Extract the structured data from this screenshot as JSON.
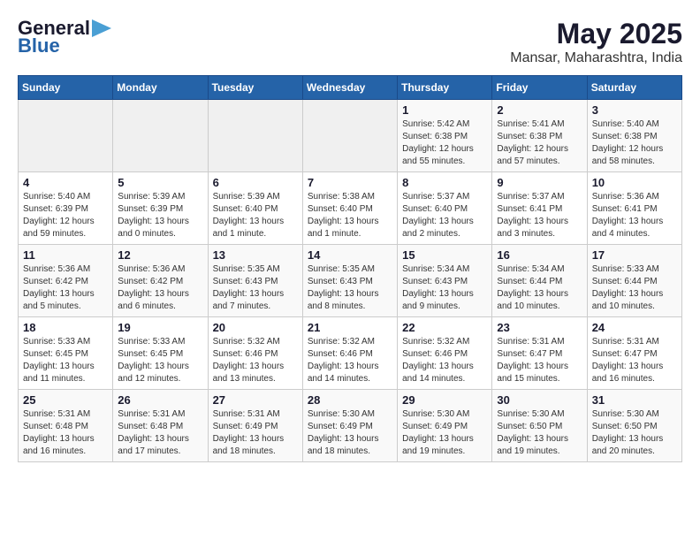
{
  "logo": {
    "line1": "General",
    "line2": "Blue"
  },
  "title": "May 2025",
  "subtitle": "Mansar, Maharashtra, India",
  "days_of_week": [
    "Sunday",
    "Monday",
    "Tuesday",
    "Wednesday",
    "Thursday",
    "Friday",
    "Saturday"
  ],
  "weeks": [
    [
      {
        "day": "",
        "info": ""
      },
      {
        "day": "",
        "info": ""
      },
      {
        "day": "",
        "info": ""
      },
      {
        "day": "",
        "info": ""
      },
      {
        "day": "1",
        "info": "Sunrise: 5:42 AM\nSunset: 6:38 PM\nDaylight: 12 hours\nand 55 minutes."
      },
      {
        "day": "2",
        "info": "Sunrise: 5:41 AM\nSunset: 6:38 PM\nDaylight: 12 hours\nand 57 minutes."
      },
      {
        "day": "3",
        "info": "Sunrise: 5:40 AM\nSunset: 6:38 PM\nDaylight: 12 hours\nand 58 minutes."
      }
    ],
    [
      {
        "day": "4",
        "info": "Sunrise: 5:40 AM\nSunset: 6:39 PM\nDaylight: 12 hours\nand 59 minutes."
      },
      {
        "day": "5",
        "info": "Sunrise: 5:39 AM\nSunset: 6:39 PM\nDaylight: 13 hours\nand 0 minutes."
      },
      {
        "day": "6",
        "info": "Sunrise: 5:39 AM\nSunset: 6:40 PM\nDaylight: 13 hours\nand 1 minute."
      },
      {
        "day": "7",
        "info": "Sunrise: 5:38 AM\nSunset: 6:40 PM\nDaylight: 13 hours\nand 1 minute."
      },
      {
        "day": "8",
        "info": "Sunrise: 5:37 AM\nSunset: 6:40 PM\nDaylight: 13 hours\nand 2 minutes."
      },
      {
        "day": "9",
        "info": "Sunrise: 5:37 AM\nSunset: 6:41 PM\nDaylight: 13 hours\nand 3 minutes."
      },
      {
        "day": "10",
        "info": "Sunrise: 5:36 AM\nSunset: 6:41 PM\nDaylight: 13 hours\nand 4 minutes."
      }
    ],
    [
      {
        "day": "11",
        "info": "Sunrise: 5:36 AM\nSunset: 6:42 PM\nDaylight: 13 hours\nand 5 minutes."
      },
      {
        "day": "12",
        "info": "Sunrise: 5:36 AM\nSunset: 6:42 PM\nDaylight: 13 hours\nand 6 minutes."
      },
      {
        "day": "13",
        "info": "Sunrise: 5:35 AM\nSunset: 6:43 PM\nDaylight: 13 hours\nand 7 minutes."
      },
      {
        "day": "14",
        "info": "Sunrise: 5:35 AM\nSunset: 6:43 PM\nDaylight: 13 hours\nand 8 minutes."
      },
      {
        "day": "15",
        "info": "Sunrise: 5:34 AM\nSunset: 6:43 PM\nDaylight: 13 hours\nand 9 minutes."
      },
      {
        "day": "16",
        "info": "Sunrise: 5:34 AM\nSunset: 6:44 PM\nDaylight: 13 hours\nand 10 minutes."
      },
      {
        "day": "17",
        "info": "Sunrise: 5:33 AM\nSunset: 6:44 PM\nDaylight: 13 hours\nand 10 minutes."
      }
    ],
    [
      {
        "day": "18",
        "info": "Sunrise: 5:33 AM\nSunset: 6:45 PM\nDaylight: 13 hours\nand 11 minutes."
      },
      {
        "day": "19",
        "info": "Sunrise: 5:33 AM\nSunset: 6:45 PM\nDaylight: 13 hours\nand 12 minutes."
      },
      {
        "day": "20",
        "info": "Sunrise: 5:32 AM\nSunset: 6:46 PM\nDaylight: 13 hours\nand 13 minutes."
      },
      {
        "day": "21",
        "info": "Sunrise: 5:32 AM\nSunset: 6:46 PM\nDaylight: 13 hours\nand 14 minutes."
      },
      {
        "day": "22",
        "info": "Sunrise: 5:32 AM\nSunset: 6:46 PM\nDaylight: 13 hours\nand 14 minutes."
      },
      {
        "day": "23",
        "info": "Sunrise: 5:31 AM\nSunset: 6:47 PM\nDaylight: 13 hours\nand 15 minutes."
      },
      {
        "day": "24",
        "info": "Sunrise: 5:31 AM\nSunset: 6:47 PM\nDaylight: 13 hours\nand 16 minutes."
      }
    ],
    [
      {
        "day": "25",
        "info": "Sunrise: 5:31 AM\nSunset: 6:48 PM\nDaylight: 13 hours\nand 16 minutes."
      },
      {
        "day": "26",
        "info": "Sunrise: 5:31 AM\nSunset: 6:48 PM\nDaylight: 13 hours\nand 17 minutes."
      },
      {
        "day": "27",
        "info": "Sunrise: 5:31 AM\nSunset: 6:49 PM\nDaylight: 13 hours\nand 18 minutes."
      },
      {
        "day": "28",
        "info": "Sunrise: 5:30 AM\nSunset: 6:49 PM\nDaylight: 13 hours\nand 18 minutes."
      },
      {
        "day": "29",
        "info": "Sunrise: 5:30 AM\nSunset: 6:49 PM\nDaylight: 13 hours\nand 19 minutes."
      },
      {
        "day": "30",
        "info": "Sunrise: 5:30 AM\nSunset: 6:50 PM\nDaylight: 13 hours\nand 19 minutes."
      },
      {
        "day": "31",
        "info": "Sunrise: 5:30 AM\nSunset: 6:50 PM\nDaylight: 13 hours\nand 20 minutes."
      }
    ]
  ]
}
